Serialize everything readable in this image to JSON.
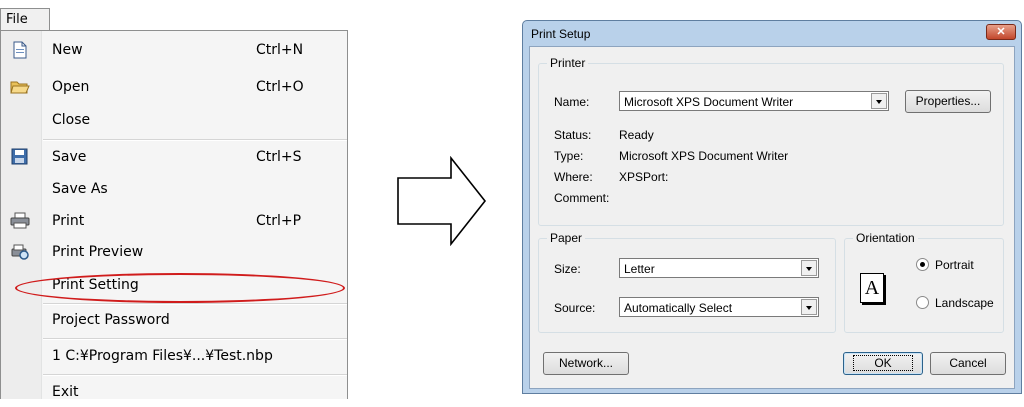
{
  "menu_bar": {
    "file": "File"
  },
  "menu": {
    "items": [
      {
        "label": "New",
        "shortcut": "Ctrl+N"
      },
      {
        "label": "Open",
        "shortcut": "Ctrl+O"
      },
      {
        "label": "Close",
        "shortcut": ""
      },
      {
        "label": "Save",
        "shortcut": "Ctrl+S"
      },
      {
        "label": "Save As",
        "shortcut": ""
      },
      {
        "label": "Print",
        "shortcut": "Ctrl+P"
      },
      {
        "label": "Print Preview",
        "shortcut": ""
      },
      {
        "label": "Print Setting",
        "shortcut": ""
      },
      {
        "label": "Project Password",
        "shortcut": ""
      },
      {
        "label": "1 C:¥Program Files¥...¥Test.nbp",
        "shortcut": ""
      },
      {
        "label": "Exit",
        "shortcut": ""
      }
    ],
    "highlighted": "Print Setting",
    "highlight_color": "#d01c1c"
  },
  "dialog": {
    "title": "Print Setup",
    "printer": {
      "legend": "Printer",
      "name_label": "Name:",
      "name_value": "Microsoft XPS Document Writer",
      "properties_button": "Properties...",
      "status_label": "Status:",
      "status_value": "Ready",
      "type_label": "Type:",
      "type_value": "Microsoft XPS Document Writer",
      "where_label": "Where:",
      "where_value": "XPSPort:",
      "comment_label": "Comment:",
      "comment_value": ""
    },
    "paper": {
      "legend": "Paper",
      "size_label": "Size:",
      "size_value": "Letter",
      "source_label": "Source:",
      "source_value": "Automatically Select"
    },
    "orientation": {
      "legend": "Orientation",
      "icon_letter": "A",
      "portrait": "Portrait",
      "landscape": "Landscape",
      "selected": "Portrait"
    },
    "network_button": "Network...",
    "ok_button": "OK",
    "cancel_button": "Cancel",
    "close_glyph": "✕"
  },
  "colors": {
    "dialog_frame": "#b9d1ea",
    "close_button": "#c2472c",
    "menu_background": "#f5f5f5"
  }
}
